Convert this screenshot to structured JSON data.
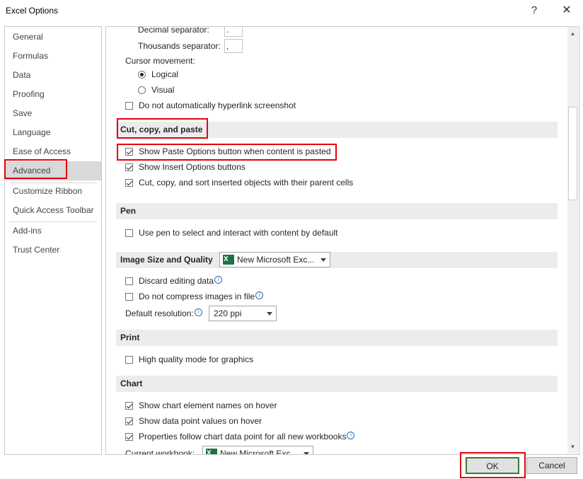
{
  "window": {
    "title": "Excel Options",
    "help": "?",
    "close": "✕"
  },
  "sidebar": {
    "items": [
      {
        "label": "General"
      },
      {
        "label": "Formulas"
      },
      {
        "label": "Data"
      },
      {
        "label": "Proofing"
      },
      {
        "label": "Save"
      },
      {
        "label": "Language"
      },
      {
        "label": "Ease of Access"
      },
      {
        "label": "Advanced",
        "selected": true
      },
      {
        "label": "Customize Ribbon"
      },
      {
        "label": "Quick Access Toolbar"
      },
      {
        "label": "Add-ins"
      },
      {
        "label": "Trust Center"
      }
    ]
  },
  "content": {
    "decimal_separator": {
      "label": "Decimal separator:",
      "value": "."
    },
    "thousands_separator": {
      "label": "Thousands separator:",
      "value": ","
    },
    "cursor_movement": {
      "label": "Cursor movement:",
      "logical": "Logical",
      "visual": "Visual",
      "selected": "Logical"
    },
    "hyperlink_screenshot": {
      "label": "Do not automatically hyperlink screenshot",
      "checked": false
    },
    "cut_copy_paste": {
      "header": "Cut, copy, and paste",
      "show_paste_options": {
        "label": "Show Paste Options button when content is pasted",
        "checked": true
      },
      "show_insert_options": {
        "label": "Show Insert Options buttons",
        "checked": true
      },
      "cut_copy_sort": {
        "label": "Cut, copy, and sort inserted objects with their parent cells",
        "checked": true
      }
    },
    "pen": {
      "header": "Pen",
      "use_pen": {
        "label": "Use pen to select and interact with content by default",
        "checked": false
      }
    },
    "image_size": {
      "header": "Image Size and Quality",
      "workbook": "New Microsoft Exc...",
      "discard_editing": {
        "label": "Discard editing data",
        "checked": false
      },
      "no_compress": {
        "label": "Do not compress images in file",
        "checked": false
      },
      "default_resolution": {
        "label": "Default resolution:",
        "value": "220 ppi"
      }
    },
    "print": {
      "header": "Print",
      "high_quality": {
        "label": "High quality mode for graphics",
        "checked": false
      }
    },
    "chart": {
      "header": "Chart",
      "element_names": {
        "label": "Show chart element names on hover",
        "checked": true
      },
      "point_values": {
        "label": "Show data point values on hover",
        "checked": true
      },
      "properties_follow": {
        "label": "Properties follow chart data point for all new workbooks",
        "checked": true
      },
      "current_workbook": {
        "label": "Current workbook:",
        "value": "New Microsoft Exc..."
      }
    }
  },
  "footer": {
    "ok": "OK",
    "cancel": "Cancel"
  },
  "colors": {
    "highlight": "#e3000f",
    "excel_green": "#1e7145"
  }
}
